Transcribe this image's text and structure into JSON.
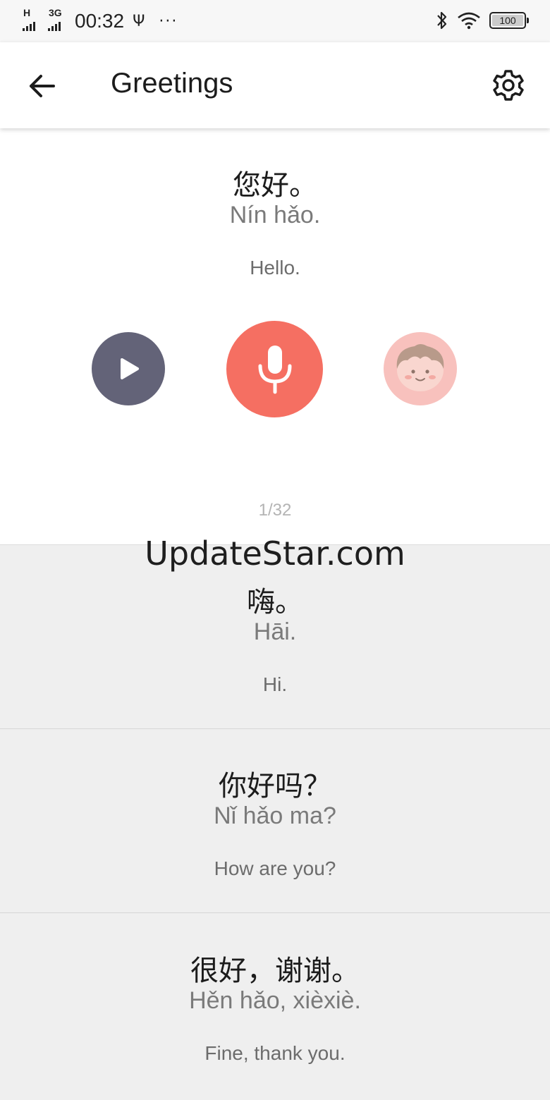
{
  "status_bar": {
    "signal1_label": "H",
    "signal2_label": "3G",
    "time": "00:32",
    "usb_glyph": "Ψ",
    "more": "···",
    "battery": "100",
    "battery_level": 1.0,
    "icons": [
      "bluetooth-icon",
      "wifi-icon",
      "battery-icon"
    ]
  },
  "app_bar": {
    "title": "Greetings",
    "back_icon": "arrow-left-icon",
    "settings_icon": "gear-icon"
  },
  "active_phrase": {
    "chinese": "您好。",
    "pinyin": "Nín hǎo.",
    "english": "Hello.",
    "counter": "1/32"
  },
  "controls": {
    "play_icon": "play-icon",
    "record_icon": "microphone-icon",
    "avatar_icon": "cartoon-face-icon"
  },
  "watermark": "UpdateStar.com",
  "phrases": [
    {
      "chinese": "嗨。",
      "pinyin": "Hāi.",
      "english": "Hi."
    },
    {
      "chinese": "你好吗？",
      "pinyin": "Nǐ hǎo ma?",
      "english": "How are you?"
    },
    {
      "chinese": "很好，谢谢。",
      "pinyin": "Hěn hǎo, xièxiè.",
      "english": "Fine, thank you."
    }
  ],
  "colors": {
    "accent_record": "#f56f62",
    "play_button": "#636378",
    "avatar_bg": "#f8c1bd",
    "list_bg": "#efefef"
  }
}
